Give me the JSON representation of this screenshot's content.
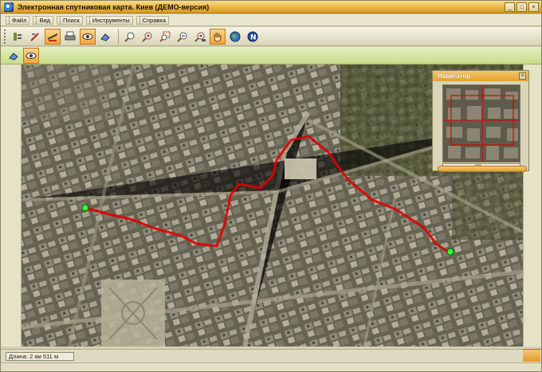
{
  "window": {
    "title": "Электронная спутниковая карта. Киев (ДЕМО-версия)",
    "controls": [
      "_",
      "□",
      "×"
    ]
  },
  "menu": [
    {
      "label": "Файл",
      "name": "menu-file"
    },
    {
      "label": "Вид",
      "name": "menu-view"
    },
    {
      "label": "Поиск",
      "name": "menu-search"
    },
    {
      "label": "Инструменты",
      "name": "menu-tools"
    },
    {
      "label": "Справка",
      "name": "menu-help"
    }
  ],
  "toolbar": {
    "tools": [
      {
        "icon": "layers-icon",
        "active": false
      },
      {
        "icon": "draw-route-icon",
        "active": false
      },
      {
        "icon": "edit-route-icon",
        "active": true
      },
      {
        "icon": "print-icon",
        "active": false
      },
      {
        "icon": "eye-icon",
        "active": true
      },
      {
        "icon": "eraser-icon",
        "active": false
      },
      {
        "icon": "zoom-in-icon",
        "active": false
      },
      {
        "icon": "zoom-in-plus-icon",
        "active": false
      },
      {
        "icon": "zoom-rect-icon",
        "active": false
      },
      {
        "icon": "zoom-out-icon",
        "active": false
      },
      {
        "icon": "zoom-full-icon",
        "active": false
      },
      {
        "icon": "hand-pan-icon",
        "active": true
      },
      {
        "icon": "globe-icon",
        "active": false
      },
      {
        "icon": "compass-north-icon",
        "active": false
      }
    ]
  },
  "toolbar2": {
    "tools": [
      {
        "icon": "eraser-icon",
        "active": false
      },
      {
        "icon": "eye-icon",
        "active": true
      }
    ]
  },
  "navigator": {
    "title": "Навигатор",
    "close": "×"
  },
  "status": {
    "length_text": "Длина: 2 км 511 м"
  },
  "colors": {
    "title_orange": "#e9b23d",
    "route": "#e00000",
    "waypoint": "#33ff33",
    "green_toolbar": "#c7dc8a"
  }
}
